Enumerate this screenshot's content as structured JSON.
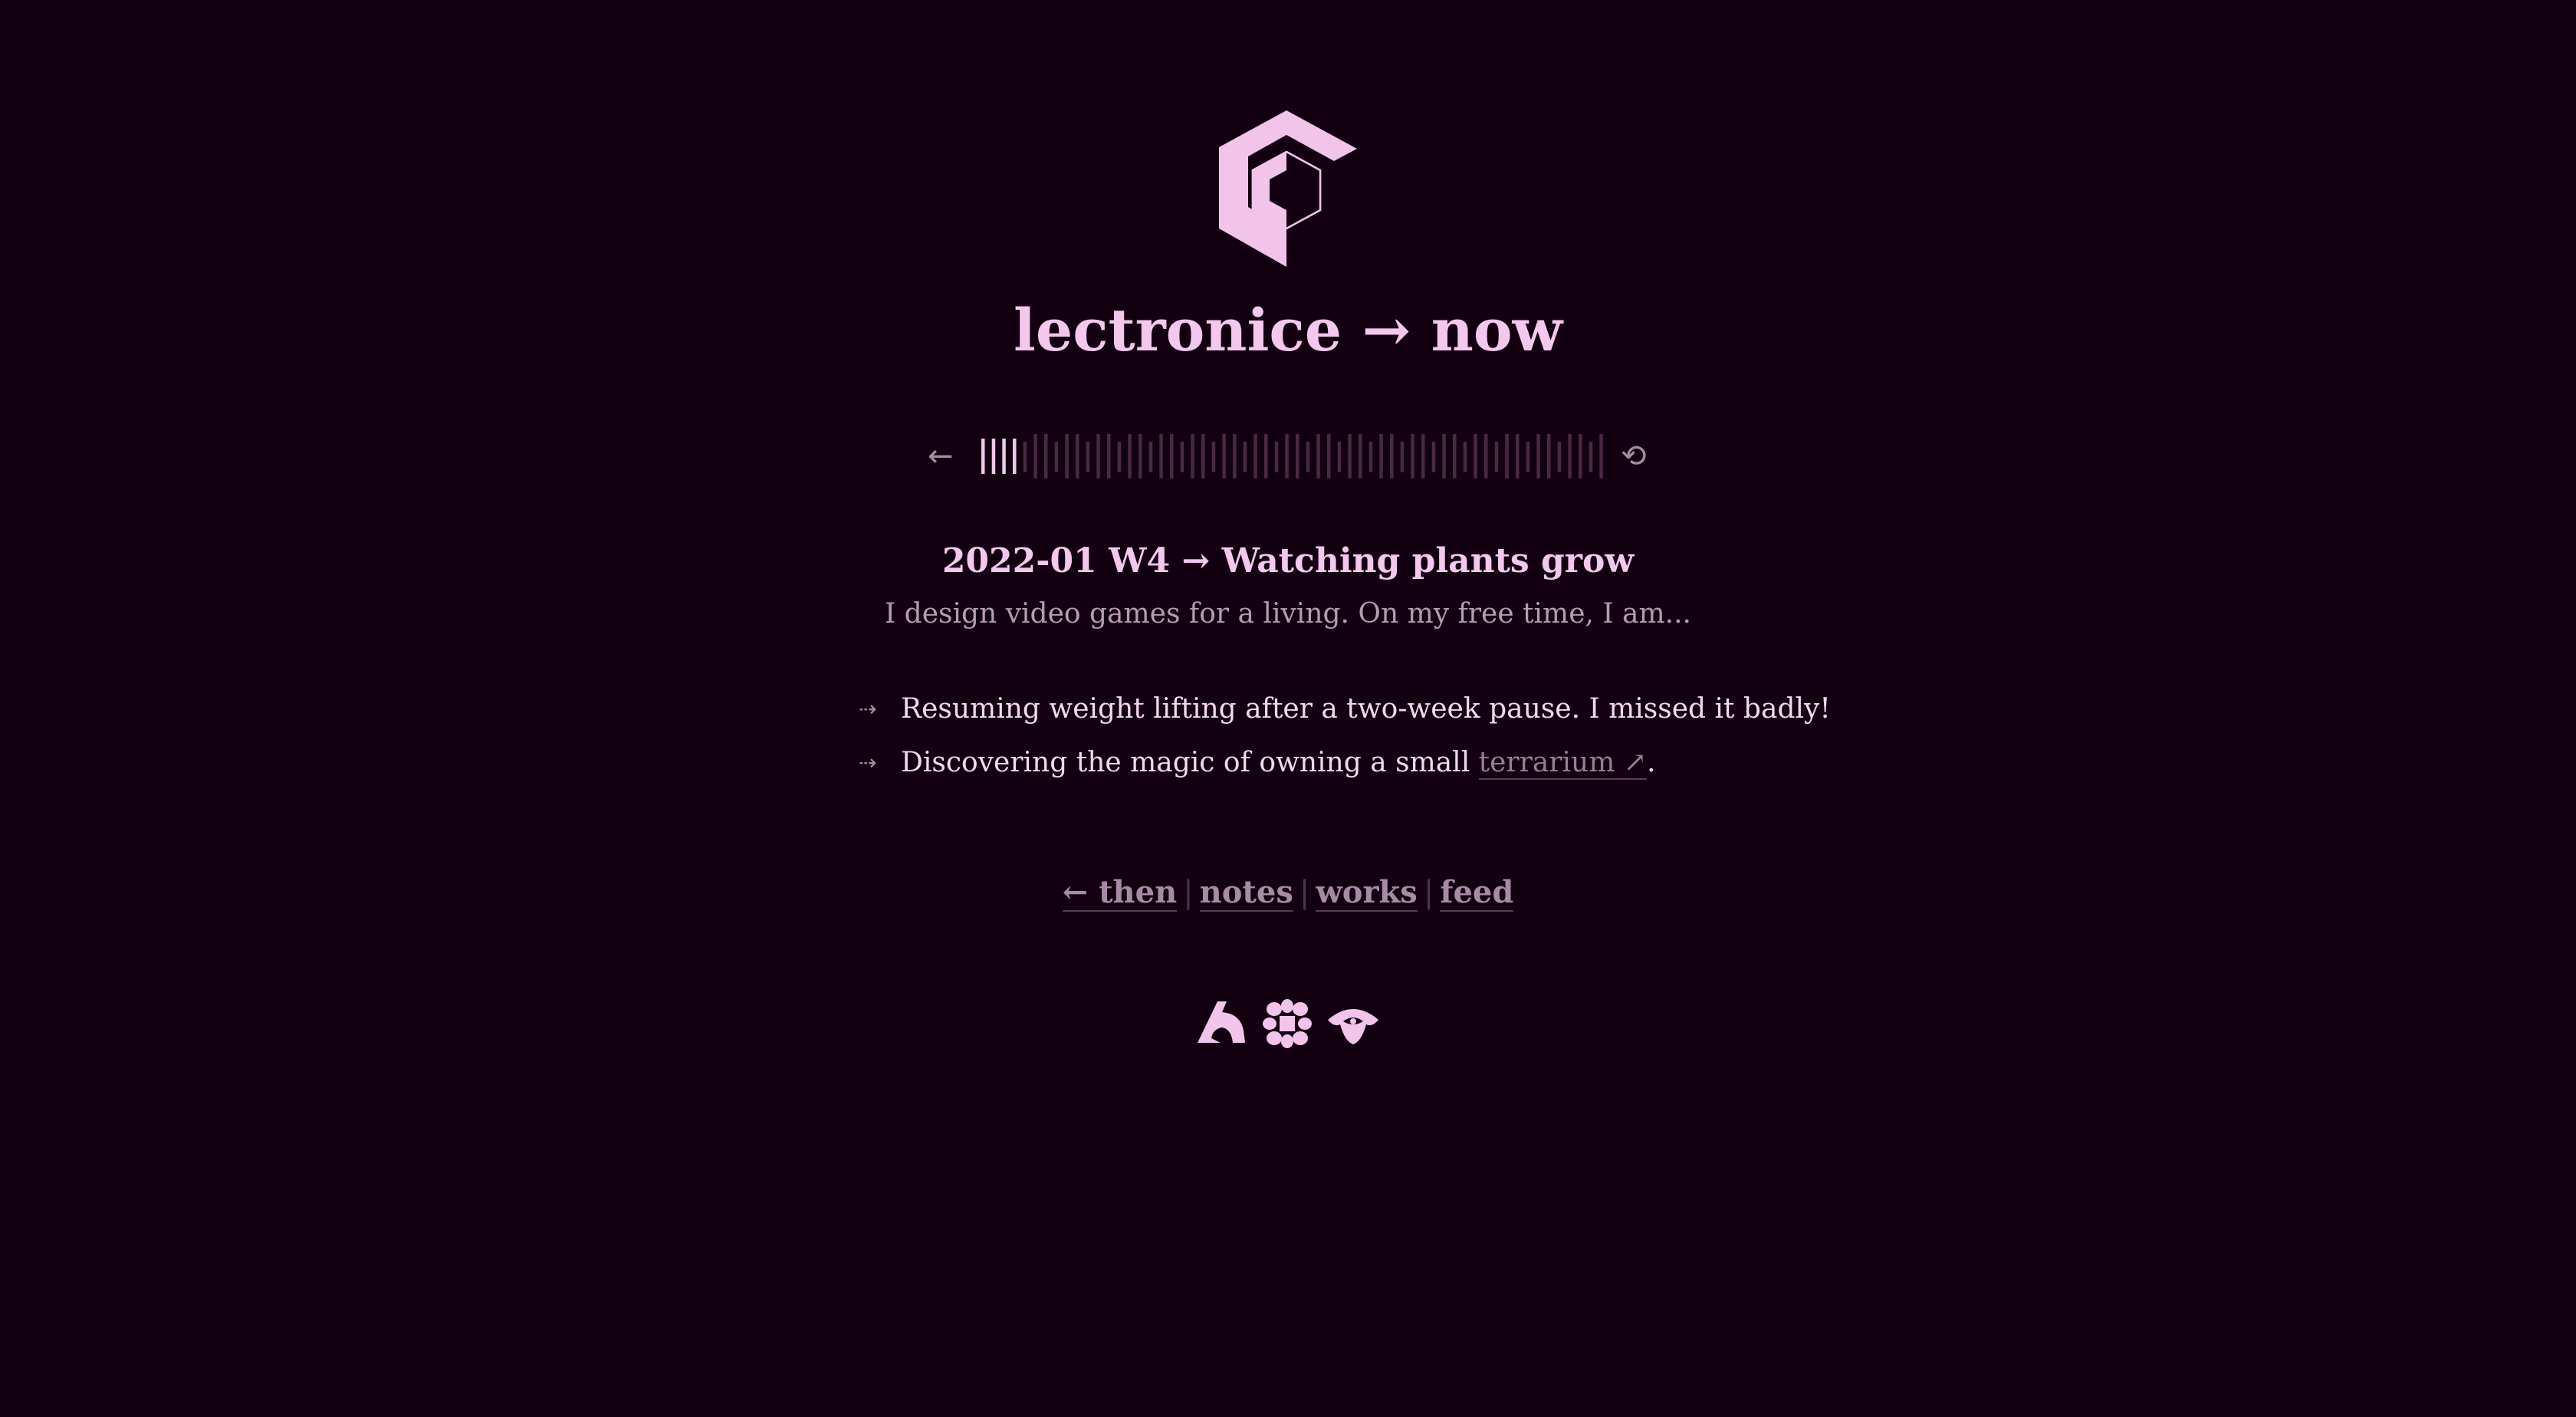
{
  "site": {
    "title": "lectronice → now",
    "logo_icon": "hexagon-cube-logo"
  },
  "timeline": {
    "prev_icon": "←",
    "reset_icon": "⟲",
    "total_entries": 60,
    "current_index": 3,
    "accent_color": "#f4c8ee",
    "inactive_color": "#4a2845"
  },
  "entry": {
    "title": "2022-01 W4 → Watching plants grow",
    "intro": "I design video games for a living. On my free time, I am...",
    "bullet_glyph": "⇢",
    "items": [
      {
        "text": "Resuming weight lifting after a two-week pause. I missed it badly!"
      },
      {
        "text_before": "Discovering the magic of owning a small ",
        "link_label": "terrarium ↗",
        "text_after": "."
      }
    ]
  },
  "nav": {
    "then_label": "← then",
    "notes_label": "notes",
    "works_label": "works",
    "feed_label": "feed",
    "separator": "|"
  },
  "footer_glyphs": [
    "tri-glyph-icon",
    "petal-grid-icon",
    "eye-wing-icon"
  ],
  "colors": {
    "background": "#120010",
    "text": "#f4c8ee",
    "muted": "#a98aa6"
  }
}
